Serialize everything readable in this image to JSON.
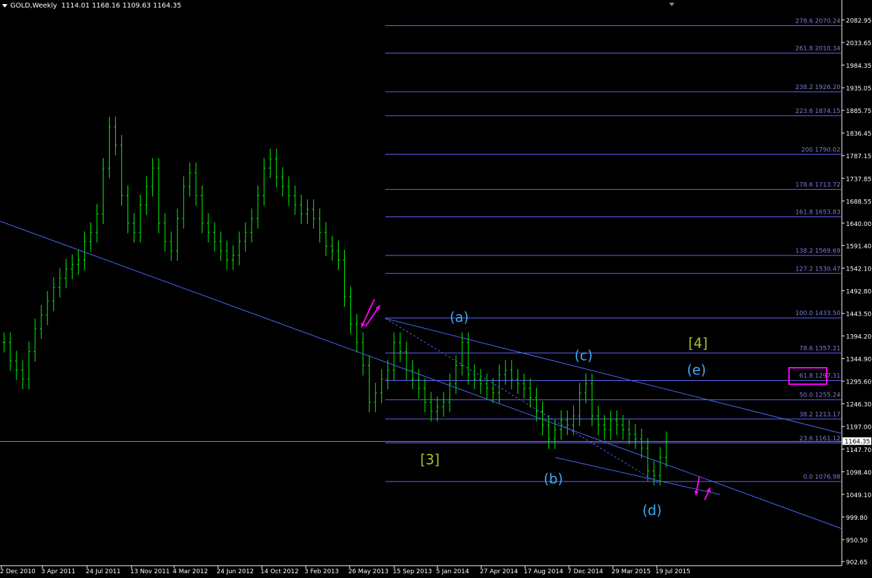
{
  "header": {
    "symbol": "GOLD,Weekly",
    "ohlc": "1114.01 1168.16 1109.63 1164.35"
  },
  "colors": {
    "background": "#000000",
    "candles": "#00ff00",
    "fib_lines": "#6666ff",
    "fib_text": "#7b7bdc",
    "trendlines": "#4b6bff",
    "wave_labels_abc": "#3fa9f5",
    "wave_labels_count": "#a8c030",
    "arrows": "#ff00ff",
    "axis_text": "#ffffff",
    "price_line": "#8a96c8"
  },
  "price_axis": {
    "ticks": [
      "2082.95",
      "2033.65",
      "1984.35",
      "1935.05",
      "1885.75",
      "1836.45",
      "1787.15",
      "1737.85",
      "1688.55",
      "1640.00",
      "1591.40",
      "1542.10",
      "1492.80",
      "1443.50",
      "1394.20",
      "1344.90",
      "1295.60",
      "1246.30",
      "1197.00",
      "1147.70",
      "1098.40",
      "1049.10",
      "999.80",
      "950.50",
      "902.65"
    ],
    "current_price": "1164.35"
  },
  "time_axis": {
    "labels": [
      "2 Dec 2010",
      "3 Apr 2011",
      "24 Jul 2011",
      "13 Nov 2011",
      "4 Mar 2012",
      "24 Jun 2012",
      "14 Oct 2012",
      "3 Feb 2013",
      "26 May 2013",
      "15 Sep 2013",
      "5 Jan 2014",
      "27 Apr 2014",
      "17 Aug 2014",
      "7 Dec 2014",
      "29 Mar 2015",
      "19 Jul 2015"
    ]
  },
  "fibonacci": [
    {
      "level": "278.6",
      "price": "2070.24"
    },
    {
      "level": "261.8",
      "price": "2010.34"
    },
    {
      "level": "238.2",
      "price": "1926.20"
    },
    {
      "level": "223.6",
      "price": "1874.15"
    },
    {
      "level": "200",
      "price": "1790.02"
    },
    {
      "level": "178.6",
      "price": "1713.72"
    },
    {
      "level": "161.8",
      "price": "1653.83"
    },
    {
      "level": "138.2",
      "price": "1569.69"
    },
    {
      "level": "127.2",
      "price": "1530.47"
    },
    {
      "level": "100.0",
      "price": "1433.50"
    },
    {
      "level": "78.6",
      "price": "1357.21"
    },
    {
      "level": "61.8",
      "price": "1297.31"
    },
    {
      "level": "50.0",
      "price": "1255.24"
    },
    {
      "level": "38.2",
      "price": "1213.17"
    },
    {
      "level": "23.6",
      "price": "1161.12"
    },
    {
      "level": "0.0",
      "price": "1076.98"
    }
  ],
  "wave_labels": {
    "a": "(a)",
    "b": "(b)",
    "c": "(c)",
    "d": "(d)",
    "e": "(e)",
    "three": "[3]",
    "four": "[4]"
  },
  "chart_data": {
    "type": "candlestick",
    "title": "GOLD,Weekly",
    "xlabel": "",
    "ylabel": "",
    "ylim": [
      902.65,
      2110
    ],
    "grid": false,
    "series": [
      {
        "name": "",
        "values": [
          1380,
          1340,
          1320,
          1300,
          1360,
          1410,
          1440,
          1470,
          1500,
          1520,
          1540,
          1550,
          1560,
          1600,
          1620,
          1660,
          1760,
          1850,
          1810,
          1700,
          1640,
          1620,
          1680,
          1720,
          1760,
          1640,
          1600,
          1580,
          1650,
          1720,
          1750,
          1700,
          1640,
          1620,
          1600,
          1580,
          1560,
          1570,
          1600,
          1620,
          1650,
          1700,
          1760,
          1780,
          1740,
          1720,
          1700,
          1680,
          1660,
          1670,
          1650,
          1620,
          1590,
          1580,
          1560,
          1480,
          1420,
          1380,
          1330,
          1250,
          1270,
          1300,
          1320,
          1380,
          1360,
          1320,
          1300,
          1280,
          1250,
          1230,
          1240,
          1250,
          1290,
          1330,
          1380,
          1310,
          1300,
          1290,
          1280,
          1270,
          1310,
          1320,
          1300,
          1290,
          1280,
          1260,
          1230,
          1200,
          1170,
          1190,
          1210,
          1200,
          1220,
          1270,
          1290,
          1220,
          1200,
          1190,
          1210,
          1200,
          1190,
          1180,
          1170,
          1150,
          1100,
          1090,
          1130,
          1164
        ]
      }
    ],
    "trendlines": [
      {
        "name": "upper-channel",
        "from": [
          "2 Dec 2010",
          1640
        ],
        "to": [
          "end",
          970
        ]
      },
      {
        "name": "wave-a-c-line",
        "from": [
          "26 May 2013",
          1433.5
        ],
        "to": [
          "end",
          1190
        ]
      },
      {
        "name": "wave-b-d-line",
        "from": [
          "17 Aug 2014",
          1130
        ],
        "to": [
          "end",
          970
        ]
      }
    ],
    "current_price": 1164.35
  }
}
